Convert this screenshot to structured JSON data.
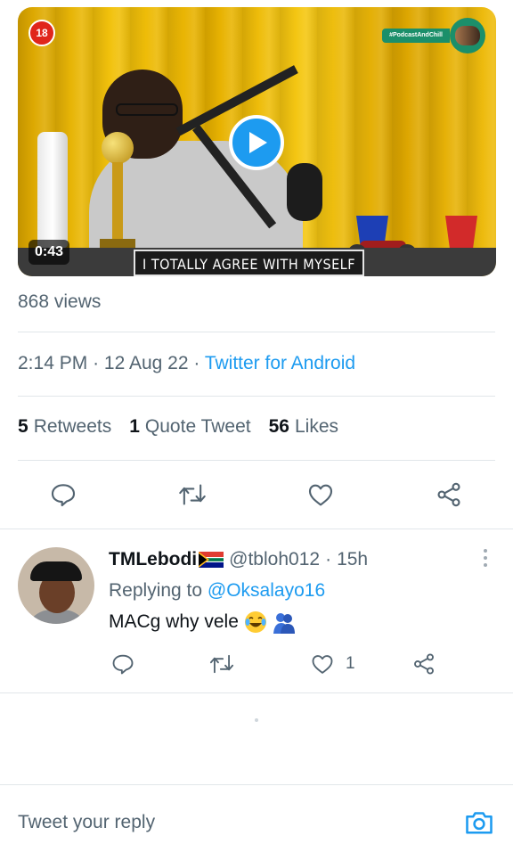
{
  "video": {
    "age_badge": "18",
    "podcast_tag": "#PodcastAndChill",
    "duration": "0:43",
    "caption": "I TOTALLY AGREE WITH MYSELF"
  },
  "tweet": {
    "views": "868 views",
    "time": "2:14 PM",
    "date": "12 Aug 22",
    "separator": "·",
    "client": "Twitter for Android",
    "retweets_count": "5",
    "retweets_label": "Retweets",
    "quotes_count": "1",
    "quotes_label": "Quote Tweet",
    "likes_count": "56",
    "likes_label": "Likes"
  },
  "reply": {
    "name": "TMLebodi",
    "handle": "@tbloh012",
    "age": "15h",
    "replying_prefix": "Replying to",
    "replying_to": "@Oksalayo16",
    "text": "MACg why vele",
    "likes": "1"
  },
  "composer": {
    "placeholder": "Tweet your reply"
  },
  "colors": {
    "accent": "#1d9bf0",
    "secondary_text": "#536471",
    "badge_red": "#e0261b"
  },
  "icons": [
    "reply-icon",
    "retweet-icon",
    "like-icon",
    "share-icon",
    "camera-icon",
    "play-icon",
    "more-icon"
  ]
}
